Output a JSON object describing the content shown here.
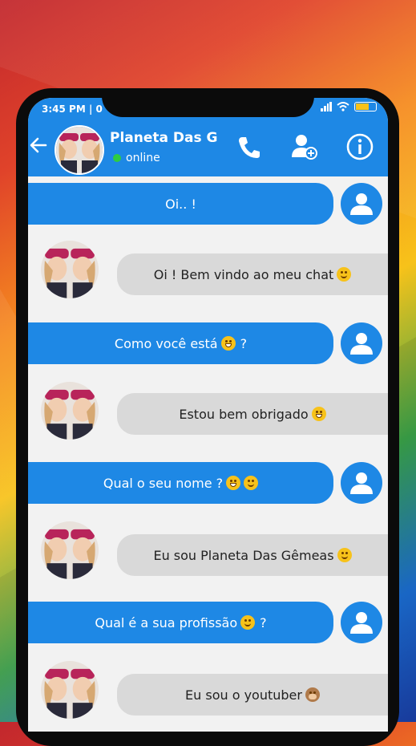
{
  "status_bar": {
    "time": "3:45 PM | 0"
  },
  "header": {
    "contact_name": "Planeta Das G",
    "contact_status": "online"
  },
  "messages": [
    {
      "from": "user",
      "text": "Oi.. !",
      "emoji": ""
    },
    {
      "from": "contact",
      "text": "Oi ! Bem vindo ao meu chat",
      "emoji": "smile"
    },
    {
      "from": "user",
      "text": "Como você está",
      "emoji": "grin",
      "suffix": "?"
    },
    {
      "from": "contact",
      "text": "Estou bem obrigado",
      "emoji": "laugh"
    },
    {
      "from": "user",
      "text": "Qual o seu nome ?",
      "emoji": "grin",
      "emoji2": "smile"
    },
    {
      "from": "contact",
      "text": "Eu sou Planeta Das Gêmeas",
      "emoji": "smile"
    },
    {
      "from": "user",
      "text": "Qual é a sua profissão",
      "emoji": "smile",
      "suffix": "?"
    },
    {
      "from": "contact",
      "text": "Eu sou o youtuber",
      "emoji": "monkey"
    }
  ],
  "colors": {
    "accent": "#1e88e5",
    "incoming_bubble": "#d9d9d9",
    "online": "#2ecc40"
  }
}
